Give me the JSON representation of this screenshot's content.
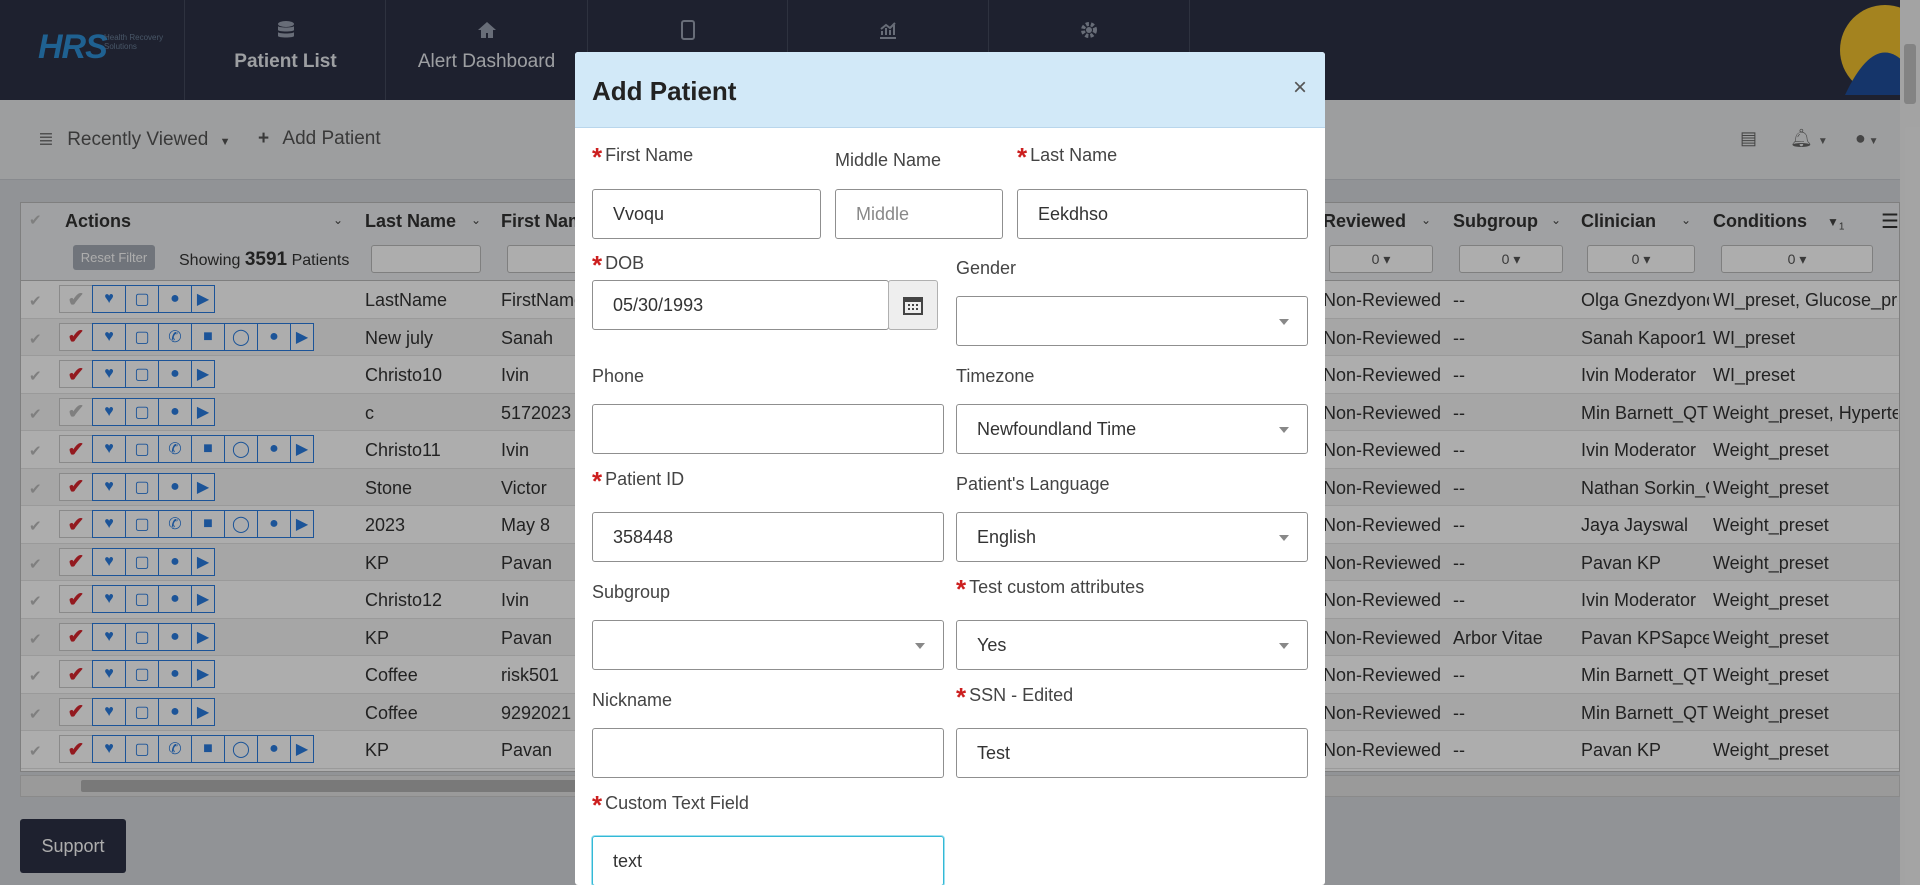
{
  "brand": {
    "logo_text": "HRS",
    "logo_sub": "Health Recovery Solutions"
  },
  "nav": {
    "tabs": [
      {
        "label": "Patient List",
        "icon": "database-icon"
      },
      {
        "label": "Alert Dashboard",
        "icon": "home-icon"
      },
      {
        "label": "",
        "icon": "tablet-icon"
      },
      {
        "label": "",
        "icon": "chart-icon"
      },
      {
        "label": "",
        "icon": "gear-icon"
      }
    ]
  },
  "toolbar": {
    "recently_viewed": "Recently Viewed",
    "add_patient": "Add Patient"
  },
  "grid": {
    "headers": {
      "actions": "Actions",
      "last_name": "Last Name",
      "first_name": "First Name",
      "reviewed": "Reviewed",
      "subgroup": "Subgroup",
      "clinician": "Clinician",
      "conditions": "Conditions",
      "conditions_sort": "1"
    },
    "reset_filter": "Reset Filter",
    "showing_prefix": "Showing",
    "showing_count": "3591",
    "showing_suffix": "Patients",
    "filter_zero": "0",
    "rows": [
      {
        "last": "LastName",
        "first": "FirstName",
        "rev": "Non-Reviewed",
        "sub": "--",
        "clin": "Olga Gnezdyonova",
        "cond": "WI_preset, Glucose_preset"
      },
      {
        "last": "New july",
        "first": "Sanah",
        "rev": "Non-Reviewed",
        "sub": "--",
        "clin": "Sanah Kapoor1",
        "cond": "WI_preset"
      },
      {
        "last": "Christo10",
        "first": "Ivin",
        "rev": "Non-Reviewed",
        "sub": "--",
        "clin": "Ivin Moderator",
        "cond": "WI_preset"
      },
      {
        "last": "c",
        "first": "5172023",
        "rev": "Non-Reviewed",
        "sub": "--",
        "clin": "Min Barnett_QT",
        "cond": "Weight_preset, Hypertension"
      },
      {
        "last": "Christo11",
        "first": "Ivin",
        "rev": "Non-Reviewed",
        "sub": "--",
        "clin": "Ivin Moderator",
        "cond": "Weight_preset"
      },
      {
        "last": "Stone",
        "first": "Victor",
        "rev": "Non-Reviewed",
        "sub": "--",
        "clin": "Nathan Sorkin_QT",
        "cond": "Weight_preset"
      },
      {
        "last": "2023",
        "first": "May 8",
        "rev": "Non-Reviewed",
        "sub": "--",
        "clin": "Jaya Jayswal",
        "cond": "Weight_preset"
      },
      {
        "last": "KP",
        "first": "Pavan",
        "rev": "Non-Reviewed",
        "sub": "--",
        "clin": "Pavan KP",
        "cond": "Weight_preset"
      },
      {
        "last": "Christo12",
        "first": "Ivin",
        "rev": "Non-Reviewed",
        "sub": "--",
        "clin": "Ivin Moderator",
        "cond": "Weight_preset"
      },
      {
        "last": "KP",
        "first": "Pavan",
        "rev": "Non-Reviewed",
        "sub": "Arbor Vitae",
        "clin": "Pavan KPSapcesPace",
        "cond": "Weight_preset"
      },
      {
        "last": "Coffee",
        "first": "risk501",
        "rev": "Non-Reviewed",
        "sub": "--",
        "clin": "Min Barnett_QT",
        "cond": "Weight_preset"
      },
      {
        "last": "Coffee",
        "first": "9292021",
        "rev": "Non-Reviewed",
        "sub": "--",
        "clin": "Min Barnett_QT",
        "cond": "Weight_preset"
      },
      {
        "last": "KP",
        "first": "Pavan",
        "rev": "Non-Reviewed",
        "sub": "--",
        "clin": "Pavan KP",
        "cond": "Weight_preset"
      }
    ]
  },
  "support": "Support",
  "modal": {
    "title": "Add Patient",
    "close": "×",
    "fields": {
      "first_name": {
        "label": "First Name",
        "value": "Vvoqu"
      },
      "middle_name": {
        "label": "Middle Name",
        "placeholder": "Middle"
      },
      "last_name": {
        "label": "Last Name",
        "value": "Eekdhso"
      },
      "dob": {
        "label": "DOB",
        "value": "05/30/1993"
      },
      "gender": {
        "label": "Gender",
        "value": ""
      },
      "phone": {
        "label": "Phone",
        "value": ""
      },
      "timezone": {
        "label": "Timezone",
        "value": "Newfoundland Time"
      },
      "patient_id": {
        "label": "Patient ID",
        "value": "358448"
      },
      "language": {
        "label": "Patient's Language",
        "value": "English"
      },
      "subgroup": {
        "label": "Subgroup",
        "value": ""
      },
      "test_custom": {
        "label": "Test custom attributes",
        "value": "Yes"
      },
      "nickname": {
        "label": "Nickname",
        "value": ""
      },
      "ssn": {
        "label": "SSN - Edited",
        "value": "Test"
      },
      "custom_text": {
        "label": "Custom Text Field",
        "value": "text"
      }
    }
  }
}
